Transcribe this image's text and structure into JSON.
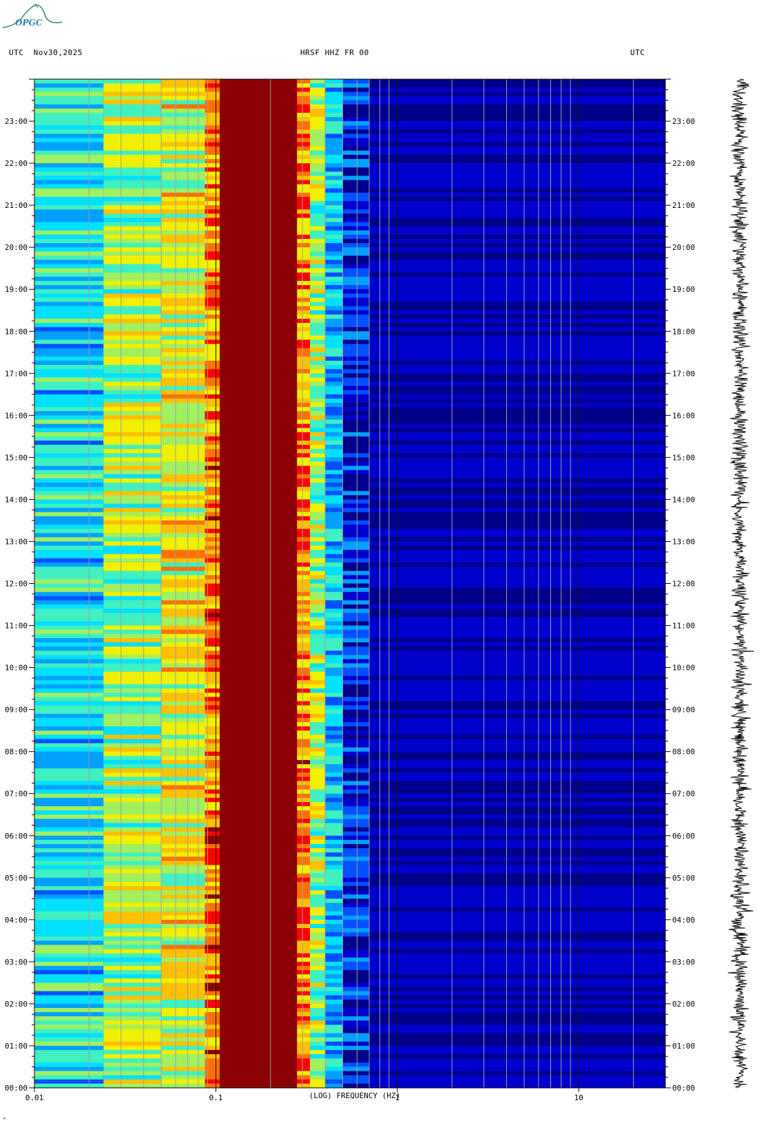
{
  "header": {
    "left": "UTC  Nov30,2025",
    "center": "HRSF HHZ FR 00",
    "right": "UTC"
  },
  "logo": {
    "text": "OPGC"
  },
  "chart_data": {
    "type": "heatmap",
    "title": "HRSF HHZ FR 00",
    "xlabel": "(LOG) FREQUENCY (HZ)",
    "x_scale": "log",
    "xlim": [
      0.01,
      30
    ],
    "x_ticks": [
      {
        "value": 0.01,
        "label": "0.01"
      },
      {
        "value": 0.1,
        "label": "0.1"
      },
      {
        "value": 1,
        "label": "1"
      },
      {
        "value": 10,
        "label": "10"
      }
    ],
    "ylabel_left": "UTC",
    "ylabel_right": "UTC",
    "y_ticks": [
      "00:00",
      "01:00",
      "02:00",
      "03:00",
      "04:00",
      "05:00",
      "06:00",
      "07:00",
      "08:00",
      "09:00",
      "10:00",
      "11:00",
      "12:00",
      "13:00",
      "14:00",
      "15:00",
      "16:00",
      "17:00",
      "18:00",
      "19:00",
      "20:00",
      "21:00",
      "22:00",
      "23:00"
    ],
    "ylim_hours": [
      0,
      24
    ],
    "colormap": [
      "#00008b",
      "#0000cd",
      "#0050ff",
      "#00a0ff",
      "#00e0ff",
      "#40f0c0",
      "#a0f060",
      "#f0f000",
      "#ffc000",
      "#ff7000",
      "#ff0000",
      "#8b0000"
    ],
    "band_levels": [
      {
        "f_min": 0.01,
        "f_max": 0.024,
        "level": 0.38
      },
      {
        "f_min": 0.024,
        "f_max": 0.05,
        "level": 0.55
      },
      {
        "f_min": 0.05,
        "f_max": 0.087,
        "level": 0.62
      },
      {
        "f_min": 0.087,
        "f_max": 0.105,
        "level": 0.8
      },
      {
        "f_min": 0.105,
        "f_max": 0.28,
        "level": 1.0
      },
      {
        "f_min": 0.28,
        "f_max": 0.33,
        "level": 0.78
      },
      {
        "f_min": 0.33,
        "f_max": 0.4,
        "level": 0.55
      },
      {
        "f_min": 0.4,
        "f_max": 0.5,
        "level": 0.32
      },
      {
        "f_min": 0.5,
        "f_max": 0.7,
        "level": 0.12
      },
      {
        "f_min": 0.7,
        "f_max": 30,
        "level": 0.05
      }
    ],
    "grid_lines_hz": [
      0.02,
      0.03,
      0.04,
      0.05,
      0.06,
      0.07,
      0.08,
      0.09,
      0.2,
      0.3,
      0.4,
      0.5,
      0.6,
      0.7,
      0.8,
      0.9,
      2,
      3,
      4,
      5,
      6,
      7,
      8,
      9,
      20
    ],
    "trace_label": "seismogram"
  },
  "footer": {
    "mark": "^"
  }
}
